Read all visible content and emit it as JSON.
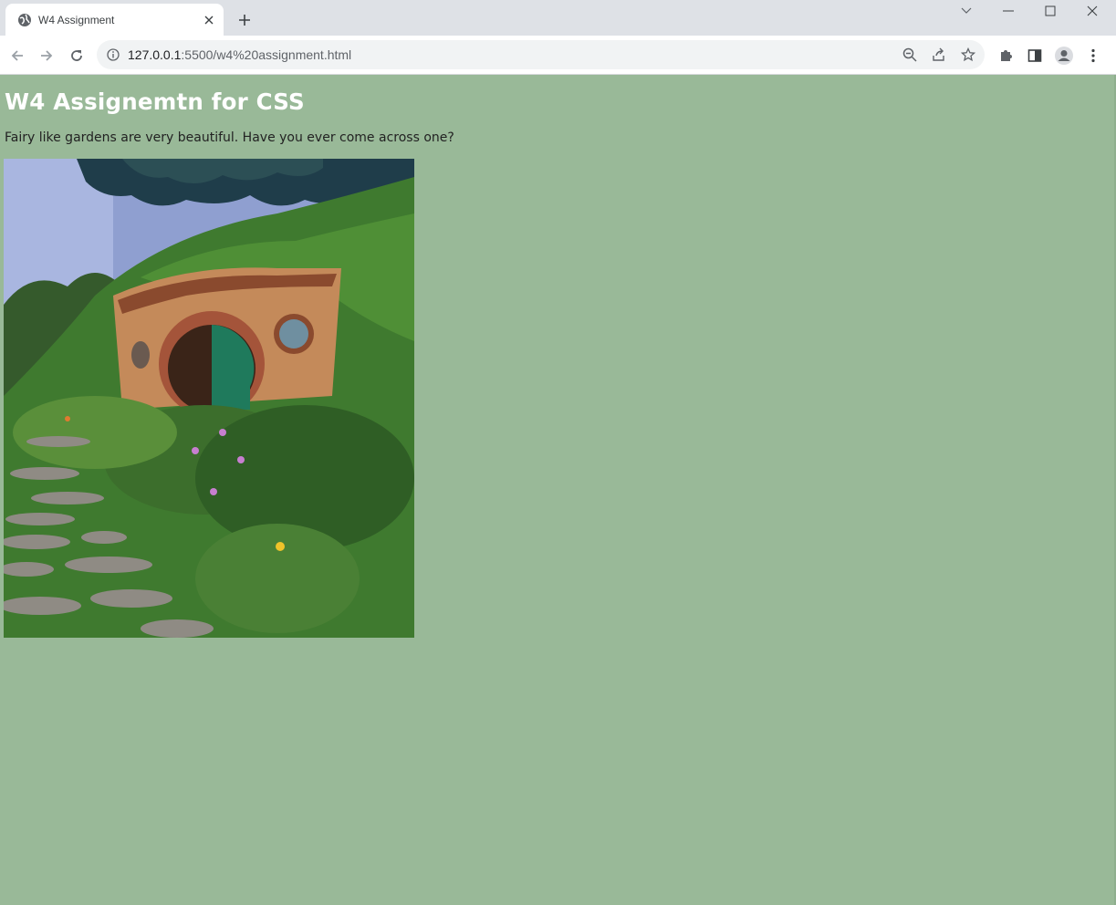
{
  "browser": {
    "tab_title": "W4 Assignment",
    "url_host": "127.0.0.1",
    "url_path": ":5500/w4%20assignment.html",
    "icons": [
      "globe-icon",
      "close-icon",
      "plus-icon",
      "chevron-down-icon",
      "minimize-icon",
      "maximize-icon",
      "close-window-icon",
      "back-arrow-icon",
      "forward-arrow-icon",
      "reload-icon",
      "info-icon",
      "zoom-icon",
      "share-icon",
      "star-icon",
      "extensions-icon",
      "side-panel-icon",
      "profile-icon",
      "kebab-menu-icon"
    ]
  },
  "page": {
    "heading": "W4 Assignemtn for CSS",
    "paragraph": "Fairy like gardens are very beautiful. Have you ever come across one?",
    "image_subject": "hobbit-hole-garden",
    "background_color": "#99b998",
    "heading_color": "#ffffff"
  }
}
